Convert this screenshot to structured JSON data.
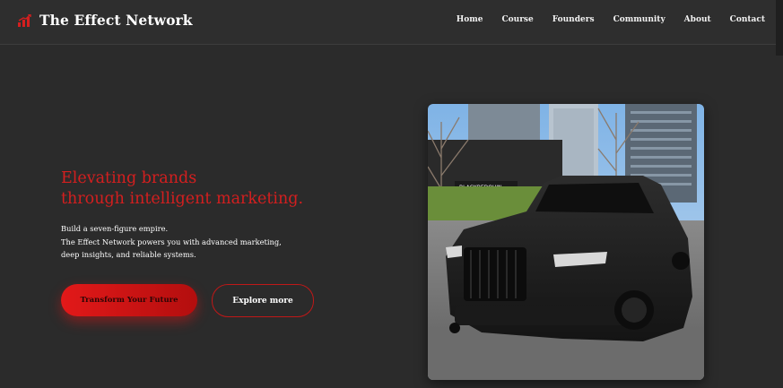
{
  "brand": {
    "name": "The Effect Network",
    "icon": "bar-chart-icon",
    "accent_color": "#d41f1f"
  },
  "nav": {
    "links": [
      "Home",
      "Course",
      "Founders",
      "Community",
      "About",
      "Contact"
    ]
  },
  "hero": {
    "headline": [
      "Elevating brands",
      "through intelligent marketing."
    ],
    "description": [
      "Build a seven-figure empire.",
      "The Effect Network powers you with advanced marketing,",
      "deep insights, and reliable systems."
    ],
    "primary_button": "Transform Your Future",
    "secondary_button": "Explore more",
    "image": {
      "subject": "black-luxury-suv-photo",
      "storefront_sign": "BLACKBEDOUIN"
    }
  }
}
